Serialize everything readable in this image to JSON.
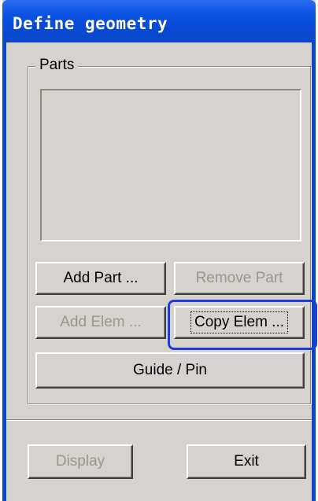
{
  "window": {
    "title": "Define geometry"
  },
  "parts_group": {
    "label": "Parts",
    "items": []
  },
  "buttons": {
    "add_part": "Add Part ...",
    "remove_part": "Remove Part",
    "add_elem": "Add Elem ...",
    "copy_elem": "Copy Elem ...",
    "guide_pin": "Guide / Pin",
    "display": "Display",
    "exit": "Exit"
  },
  "colors": {
    "titlebar": "#0a52e0",
    "dialog_bg": "#d6d3ce",
    "highlight": "#1f3cdc",
    "disabled_text": "#9a9790"
  }
}
